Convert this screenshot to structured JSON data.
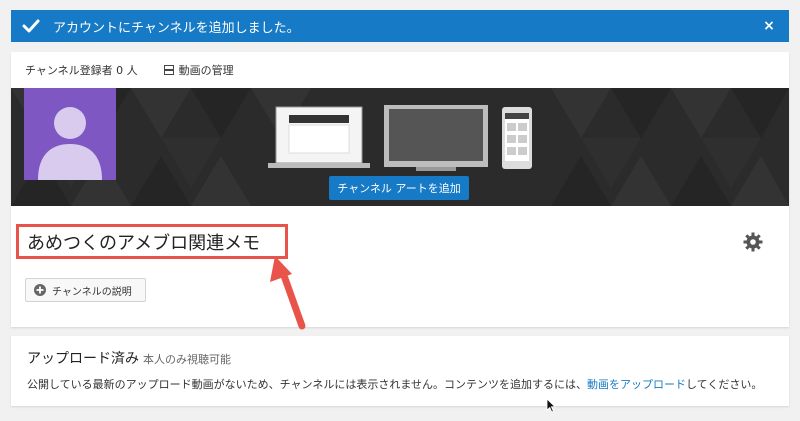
{
  "notification": {
    "message": "アカウントにチャンネルを追加しました。",
    "close": "×"
  },
  "topbar": {
    "subscribers": "チャンネル登録者 0 人",
    "manage_videos": "動画の管理"
  },
  "banner": {
    "add_art_button": "チャンネル アートを追加"
  },
  "channel": {
    "name": "あめつくのアメブロ関連メモ",
    "description_button": "チャンネルの説明"
  },
  "uploads": {
    "title": "アップロード済み",
    "visibility": "本人のみ視聴可能",
    "message_before": "公開している最新のアップロード動画がないため、チャンネルには表示されません。コンテンツを追加するには、",
    "link": "動画をアップロード",
    "message_after": "してください。"
  },
  "colors": {
    "primary_blue": "#167ac6",
    "annotation_red": "#e9544a",
    "avatar_purple": "#7e57c2"
  }
}
